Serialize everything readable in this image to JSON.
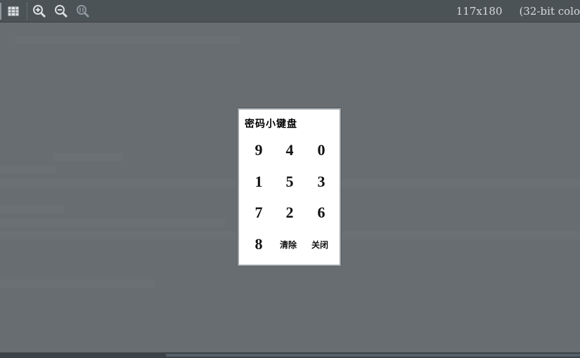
{
  "toolbar": {
    "icons": [
      "fit-window-icon",
      "zoom-in-icon",
      "zoom-out-icon",
      "zoom-actual-icon"
    ],
    "dimensions": "117x180",
    "color_depth": "(32-bit colo"
  },
  "keypad": {
    "title": "密码小键盘",
    "keys": [
      "9",
      "4",
      "0",
      "1",
      "5",
      "3",
      "7",
      "2",
      "6",
      "8",
      "清除",
      "关闭"
    ]
  }
}
